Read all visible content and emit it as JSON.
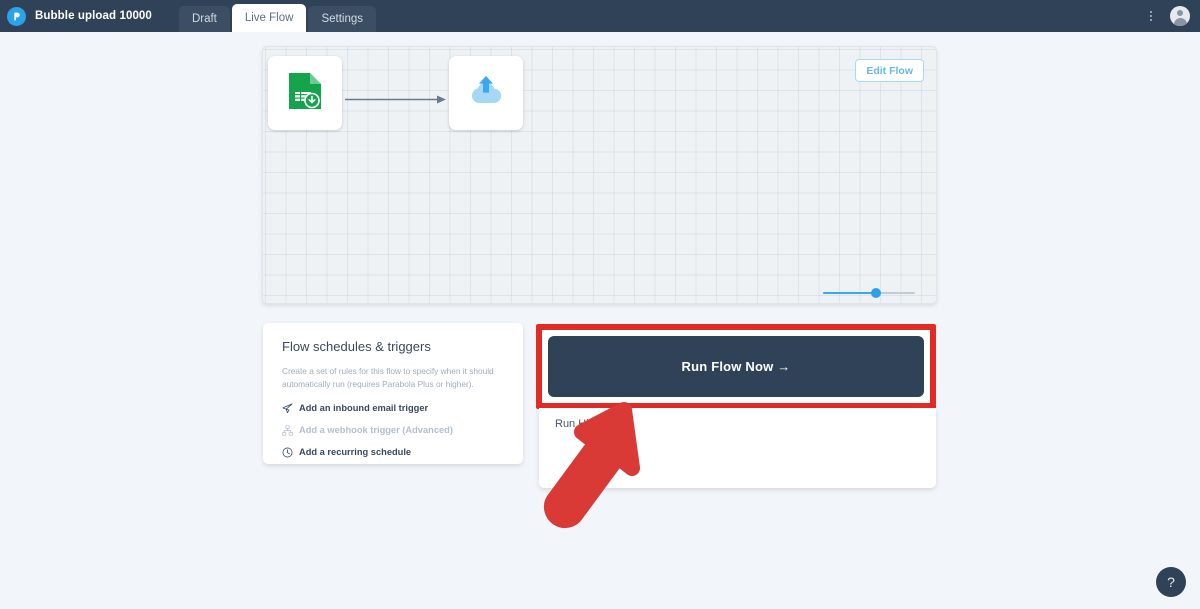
{
  "topbar": {
    "logo_icon": "parabola-logo-icon",
    "flow_title": "Bubble upload 10000",
    "tabs": [
      {
        "label": "Draft",
        "active": false
      },
      {
        "label": "Live Flow",
        "active": true
      },
      {
        "label": "Settings",
        "active": false
      }
    ],
    "kebab_icon": "more-vertical-icon",
    "avatar_icon": "user-avatar-icon",
    "background_color": "#2f4257"
  },
  "canvas": {
    "edit_flow_label": "Edit Flow",
    "nodes": [
      {
        "name": "source-spreadsheet-node",
        "icon": "spreadsheet-import-icon",
        "color": "#14a44b"
      },
      {
        "name": "destination-upload-node",
        "icon": "cloud-upload-icon",
        "color": "#9ed5f5"
      }
    ],
    "connector_icon": "arrow-right-connector",
    "zoom": {
      "label": "zoom-slider",
      "value": 52,
      "min": 0,
      "max": 100,
      "fill_color": "#3aa8ef"
    }
  },
  "schedules": {
    "title": "Flow schedules & triggers",
    "description": "Create a set of rules for this flow to specify when it should automatically run (requires Parabola Plus or higher).",
    "triggers": [
      {
        "icon": "paper-plane-icon",
        "label": "Add an inbound email trigger",
        "disabled": false
      },
      {
        "icon": "webhook-node-icon",
        "label": "Add a webhook trigger (Advanced)",
        "disabled": true
      },
      {
        "icon": "clock-icon",
        "label": "Add a recurring schedule",
        "disabled": false
      }
    ]
  },
  "run_panel": {
    "run_now_label": "Run Flow Now  →",
    "run_now_background": "#2f4257",
    "highlight_color": "#e02b27",
    "run_history_title": "Run History"
  },
  "annotation": {
    "arrow_icon": "red-pointer-arrow",
    "arrow_color": "#d93a36"
  },
  "help": {
    "label": "?",
    "icon": "question-mark-icon"
  }
}
